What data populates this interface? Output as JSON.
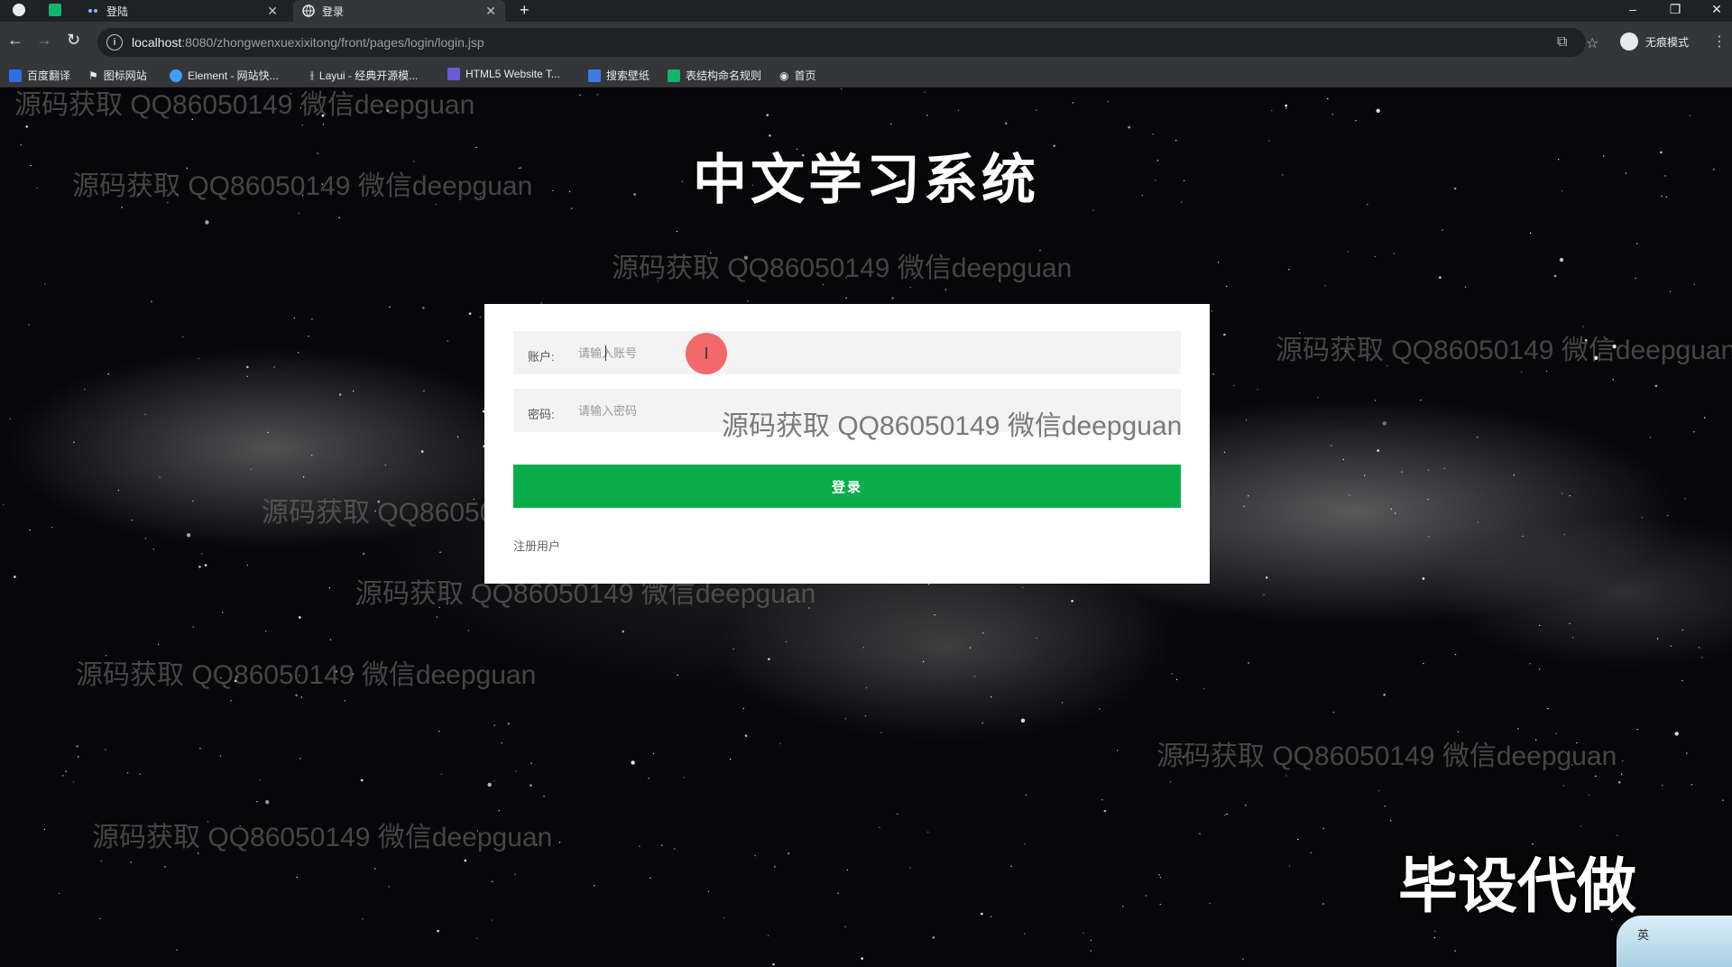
{
  "browser": {
    "tabs": [
      {
        "title": "登陆",
        "active": false
      },
      {
        "title": "登录",
        "active": true
      }
    ],
    "url_host": "localhost",
    "url_rest": ":8080/zhongwenxuexixitong/front/pages/login/login.jsp",
    "profile_label": "无痕模式",
    "bookmarks": [
      {
        "label": "百度翻译",
        "icon": "baidu-translate-icon",
        "color": "#2f6fe6"
      },
      {
        "label": "图标网站",
        "icon": "flag-icon",
        "color": "#e8eaed"
      },
      {
        "label": "Element - 网站快...",
        "icon": "element-icon",
        "color": "#409eff"
      },
      {
        "label": "Layui - 经典开源模...",
        "icon": "layui-icon",
        "color": "#e8eaed"
      },
      {
        "label": "HTML5 Website T...",
        "icon": "html5-icon",
        "color": "#6b5bd6"
      },
      {
        "label": "搜索壁纸",
        "icon": "wallpaper-icon",
        "color": "#3d7be5"
      },
      {
        "label": "表结构命名规则",
        "icon": "sheet-icon",
        "color": "#12b56a"
      },
      {
        "label": "首页",
        "icon": "globe-icon",
        "color": "#e8eaed"
      }
    ]
  },
  "page": {
    "title": "中文学习系统",
    "login": {
      "username_label": "账户:",
      "username_placeholder": "请输入账号",
      "password_label": "密码:",
      "password_placeholder": "请输入密码",
      "submit_label": "登录",
      "register_label": "注册用户"
    },
    "watermark": "源码获取 QQ86050149 微信deepguan",
    "corner_text": "毕设代做",
    "ime_label": "英"
  }
}
